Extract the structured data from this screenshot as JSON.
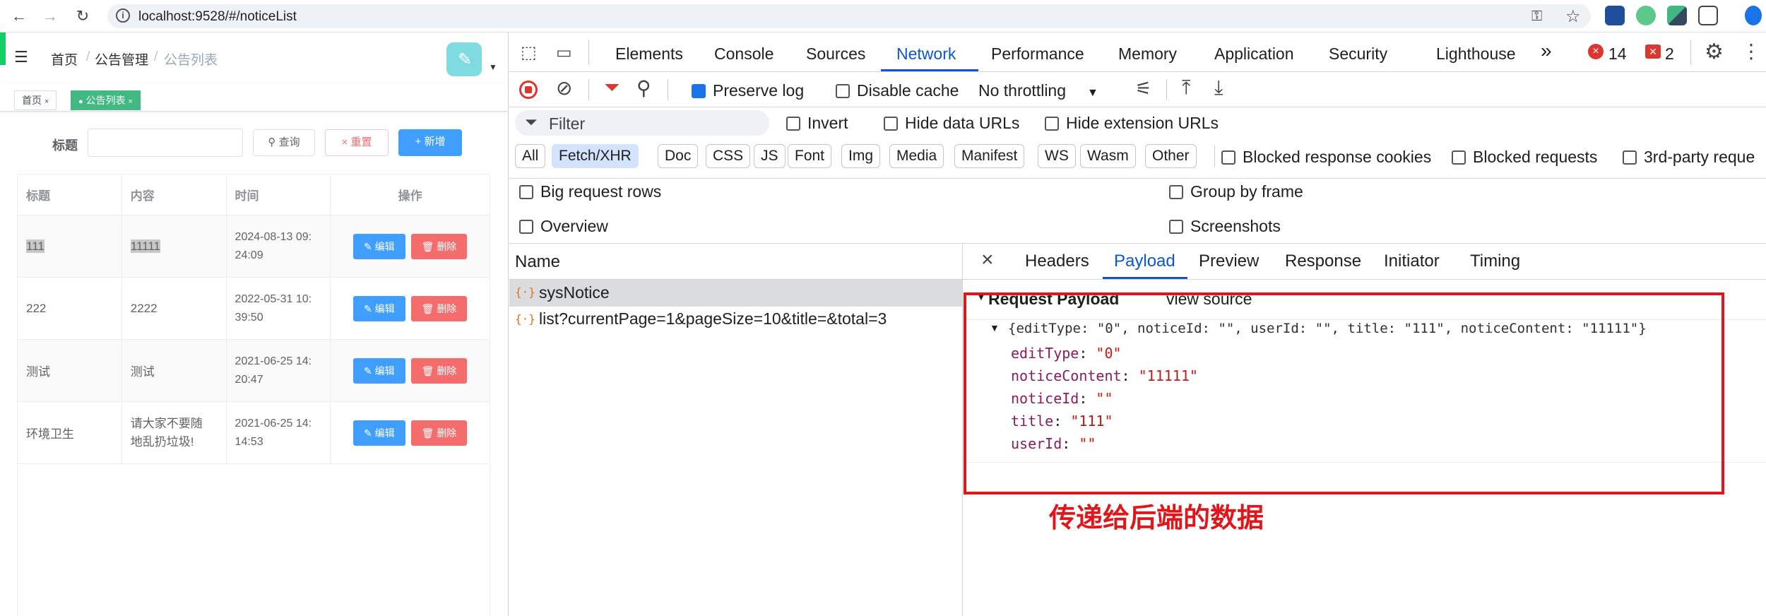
{
  "browser": {
    "url": "localhost:9528/#/noticeList"
  },
  "app": {
    "breadcrumb": [
      "首页",
      "公告管理",
      "公告列表"
    ],
    "tags": [
      "首页",
      "公告列表"
    ],
    "search": {
      "label": "标题",
      "value": "",
      "query_btn": "查询",
      "reset_btn": "重置",
      "add_btn": "新增"
    },
    "table": {
      "headers": [
        "标题",
        "内容",
        "时间",
        "操作"
      ],
      "edit_label": "编辑",
      "delete_label": "删除",
      "rows": [
        {
          "title": "111",
          "content": "11111",
          "time1": "2024-08-13 09:",
          "time2": "24:09"
        },
        {
          "title": "222",
          "content": "2222",
          "time1": "2022-05-31 10:",
          "time2": "39:50"
        },
        {
          "title": "测试",
          "content": "测试",
          "time1": "2021-06-25 14:",
          "time2": "20:47"
        },
        {
          "title": "环境卫生",
          "content1": "请大家不要随",
          "content2": "地乱扔垃圾!",
          "time1": "2021-06-25 14:",
          "time2": "14:53"
        }
      ]
    }
  },
  "devtools": {
    "tabs": [
      "Elements",
      "Console",
      "Sources",
      "Network",
      "Performance",
      "Memory",
      "Application",
      "Security",
      "Lighthouse"
    ],
    "active_tab": "Network",
    "more_tabs": "»",
    "error_count": "14",
    "warn_count": "2",
    "toolbar": {
      "preserve_log": "Preserve log",
      "disable_cache": "Disable cache",
      "throttling": "No throttling"
    },
    "filter": {
      "placeholder": "Filter",
      "invert": "Invert",
      "hide_data_urls": "Hide data URLs",
      "hide_extension_urls": "Hide extension URLs"
    },
    "type_filters": [
      "All",
      "Fetch/XHR",
      "Doc",
      "CSS",
      "JS",
      "Font",
      "Img",
      "Media",
      "Manifest",
      "WS",
      "Wasm",
      "Other"
    ],
    "active_filter": "Fetch/XHR",
    "blocked": {
      "cookies": "Blocked response cookies",
      "requests": "Blocked requests",
      "third_party": "3rd-party reque"
    },
    "options": {
      "big_rows": "Big request rows",
      "group_by_frame": "Group by frame",
      "overview": "Overview",
      "screenshots": "Screenshots"
    },
    "name_header": "Name",
    "requests": [
      "sysNotice",
      "list?currentPage=1&pageSize=10&title=&total=3"
    ],
    "detail_tabs": [
      "Headers",
      "Payload",
      "Preview",
      "Response",
      "Initiator",
      "Timing"
    ],
    "active_detail_tab": "Payload",
    "payload": {
      "section": "Request Payload",
      "view_source": "view source",
      "summary": "{editType: \"0\", noticeId: \"\", userId: \"\", title: \"111\", noticeContent: \"11111\"}",
      "fields": [
        {
          "key": "editType",
          "value": "\"0\""
        },
        {
          "key": "noticeContent",
          "value": "\"11111\""
        },
        {
          "key": "noticeId",
          "value": "\"\""
        },
        {
          "key": "title",
          "value": "\"111\""
        },
        {
          "key": "userId",
          "value": "\"\""
        }
      ]
    },
    "annotation": "传递给后端的数据"
  },
  "colors": {
    "accent": "#1a73e8",
    "annotation_red": "#e0161b",
    "tag_green": "#42b983",
    "primary": "#409eff",
    "danger": "#f56c6c"
  }
}
